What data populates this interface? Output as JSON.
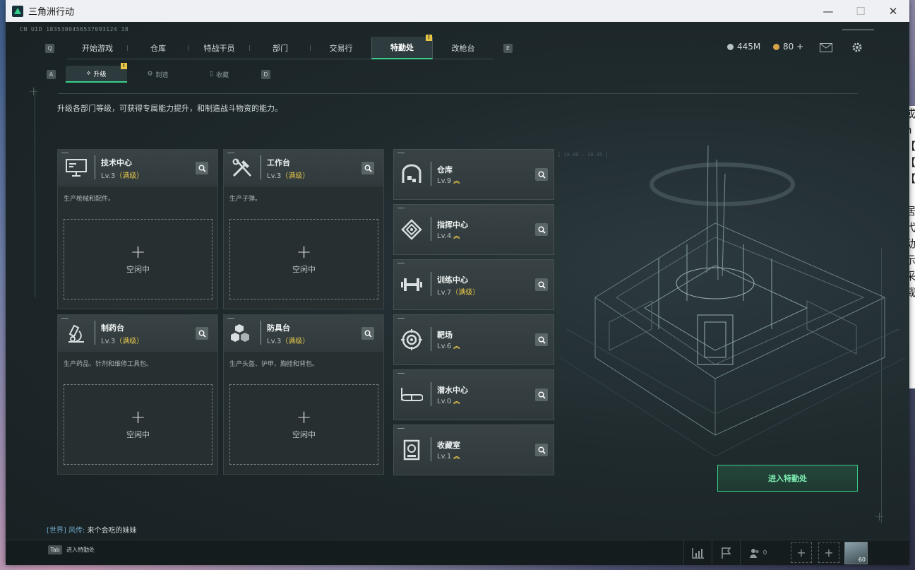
{
  "window": {
    "title": "三角洲行动",
    "minimize": "—",
    "maximize": "☐",
    "close": "✕"
  },
  "header": {
    "cnuid": "CN UID 1835300456537093124 18"
  },
  "nav": {
    "key_left": "Q",
    "key_right": "E",
    "tabs": [
      "开始游戏",
      "仓库",
      "特战干员",
      "部门",
      "交易行",
      "特勤处",
      "改枪台"
    ],
    "active": "特勤处",
    "badge": "!"
  },
  "resources": {
    "currency1": "445M",
    "currency2": "80 +"
  },
  "subnav": {
    "key_left": "A",
    "key_right": "D",
    "tabs": [
      "升级",
      "制造",
      "收藏"
    ],
    "badge": "!"
  },
  "description": "升级各部门等级，可获得专属能力提升，和制造战斗物资的能力。",
  "big_cards": [
    {
      "name": "技术中心",
      "level": "Lv.3",
      "max": "（满级）",
      "desc": "生产枪械和配件。",
      "slot_plus": "+",
      "slot_label": "空闲中",
      "icon": "monitor-icon"
    },
    {
      "name": "工作台",
      "level": "Lv.3",
      "max": "（满级）",
      "desc": "生产子弹。",
      "slot_plus": "+",
      "slot_label": "空闲中",
      "icon": "tools-icon"
    },
    {
      "name": "制药台",
      "level": "Lv.3",
      "max": "（满级）",
      "desc": "生产药品、针剂和维修工具包。",
      "slot_plus": "+",
      "slot_label": "空闲中",
      "icon": "microscope-icon"
    },
    {
      "name": "防具台",
      "level": "Lv.3",
      "max": "（满级）",
      "desc": "生产头盔、护甲、胸挂和背包。",
      "slot_plus": "+",
      "slot_label": "空闲中",
      "icon": "armor-boxes-icon"
    }
  ],
  "small_cards": [
    {
      "name": "仓库",
      "level": "Lv.9",
      "max": "",
      "upgrade": "︽",
      "icon": "warehouse-icon"
    },
    {
      "name": "指挥中心",
      "level": "Lv.4",
      "max": "",
      "upgrade": "︽",
      "icon": "command-icon"
    },
    {
      "name": "训练中心",
      "level": "Lv.7",
      "max": "（满级）",
      "upgrade": "",
      "icon": "dumbbell-icon"
    },
    {
      "name": "靶场",
      "level": "Lv.6",
      "max": "",
      "upgrade": "︽",
      "icon": "target-icon"
    },
    {
      "name": "潜水中心",
      "level": "Lv.0",
      "max": "",
      "upgrade": "︽",
      "icon": "dive-mask-icon"
    },
    {
      "name": "收藏室",
      "level": "Lv.1",
      "max": "",
      "upgrade": "︽",
      "icon": "collection-icon"
    }
  ],
  "enter_button": "进入特勤处",
  "chat": {
    "channel": "[世界]",
    "sender": "风传:",
    "message": "来个会吃的妹妹"
  },
  "bottom": {
    "tab_key": "Tab",
    "tab_label": "进入特勤处",
    "friends_count": "0",
    "avatar_level": "60"
  },
  "deco": {
    "ticker1": "[ 19.09 — 20.35 ]"
  },
  "colors": {
    "accent": "#38d08a",
    "max_level": "#e5c54b",
    "bg": "#1b2224"
  }
}
